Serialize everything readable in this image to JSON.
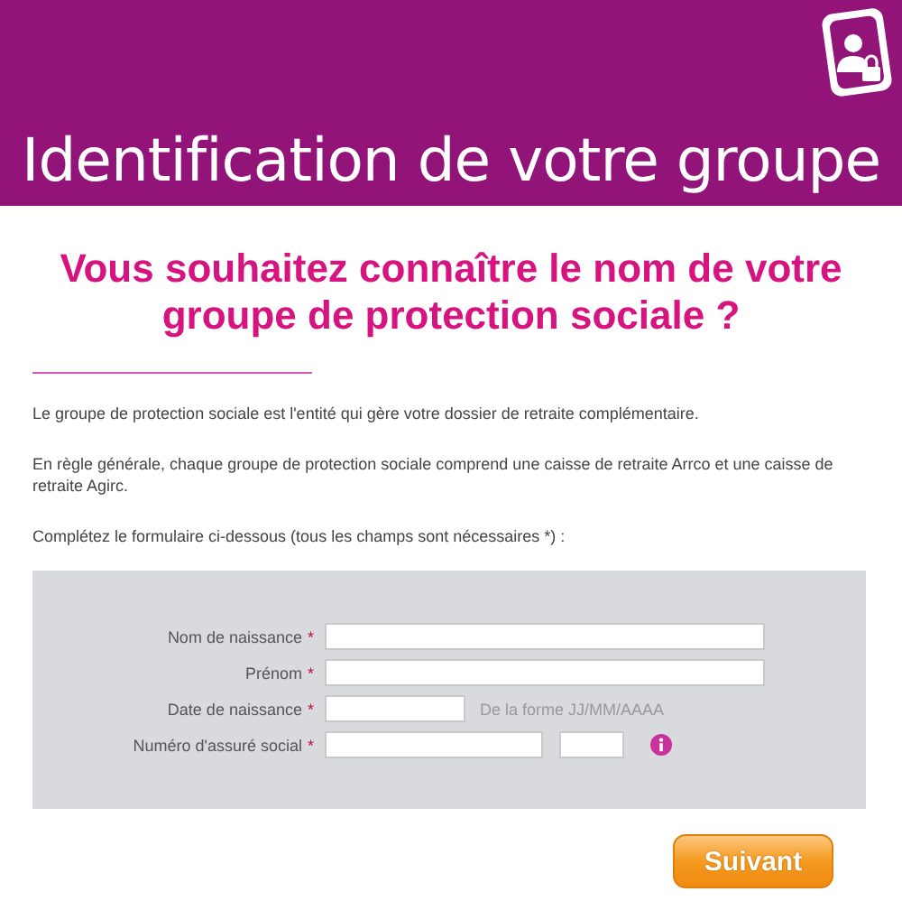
{
  "header": {
    "title": "Identification de votre groupe"
  },
  "heading": "Vous souhaitez connaître le nom de votre groupe de protection sociale ?",
  "paragraphs": [
    "Le groupe de protection sociale est l'entité qui gère votre dossier de retraite complémentaire.",
    "En règle générale, chaque groupe de protection sociale comprend une caisse de retraite Arrco et une caisse de retraite Agirc.",
    "Complétez le formulaire ci-dessous (tous les champs sont nécessaires *) :"
  ],
  "form": {
    "required_mark": "*",
    "fields": [
      {
        "kind": "text",
        "label": "Nom de naissance",
        "required": true
      },
      {
        "kind": "text",
        "label": "Prénom",
        "required": true
      },
      {
        "kind": "date",
        "label": "Date de naissance",
        "required": true,
        "hint": "De la forme JJ/MM/AAAA"
      },
      {
        "kind": "ssn",
        "label": "Numéro d'assuré social",
        "required": true
      }
    ]
  },
  "next_button": "Suivant"
}
